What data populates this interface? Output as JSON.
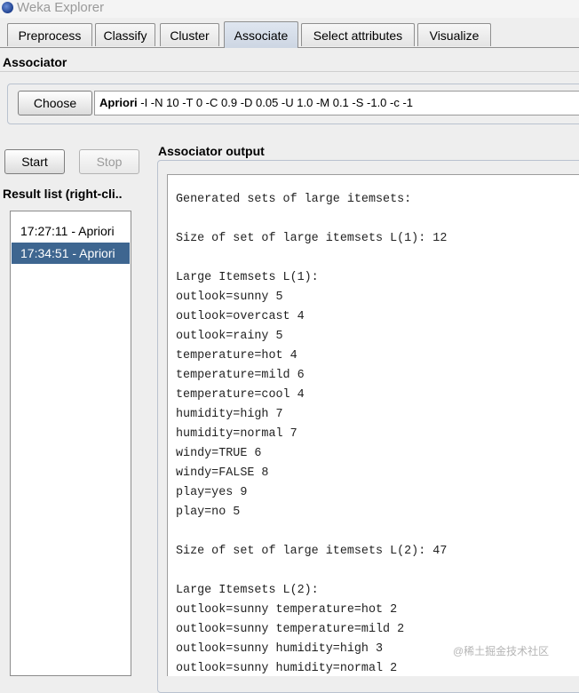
{
  "window": {
    "title": "Weka Explorer"
  },
  "tabs": [
    {
      "label": "Preprocess"
    },
    {
      "label": "Classify"
    },
    {
      "label": "Cluster"
    },
    {
      "label": "Associate",
      "active": true
    },
    {
      "label": "Select attributes"
    },
    {
      "label": "Visualize"
    }
  ],
  "associator": {
    "section_label": "Associator",
    "choose_label": "Choose",
    "algorithm": "Apriori",
    "options": " -I -N 10 -T 0 -C 0.9 -D 0.05 -U 1.0 -M 0.1 -S -1.0 -c -1"
  },
  "controls": {
    "start_label": "Start",
    "stop_label": "Stop"
  },
  "results": {
    "title": "Result list (right-cli..",
    "items": [
      {
        "label": "17:27:11 - Apriori",
        "selected": false
      },
      {
        "label": "17:34:51 - Apriori",
        "selected": true
      }
    ]
  },
  "output": {
    "title": "Associator output",
    "lines": [
      "Generated sets of large itemsets:",
      "",
      "Size of set of large itemsets L(1): 12",
      "",
      "Large Itemsets L(1):",
      "outlook=sunny 5",
      "outlook=overcast 4",
      "outlook=rainy 5",
      "temperature=hot 4",
      "temperature=mild 6",
      "temperature=cool 4",
      "humidity=high 7",
      "humidity=normal 7",
      "windy=TRUE 6",
      "windy=FALSE 8",
      "play=yes 9",
      "play=no 5",
      "",
      "Size of set of large itemsets L(2): 47",
      "",
      "Large Itemsets L(2):",
      "outlook=sunny temperature=hot 2",
      "outlook=sunny temperature=mild 2",
      "outlook=sunny humidity=high 3",
      "outlook=sunny humidity=normal 2"
    ]
  },
  "watermark": "@稀土掘金技术社区",
  "colors": {
    "selection": "#3e6690",
    "active_tab": "#cdd6e3"
  }
}
